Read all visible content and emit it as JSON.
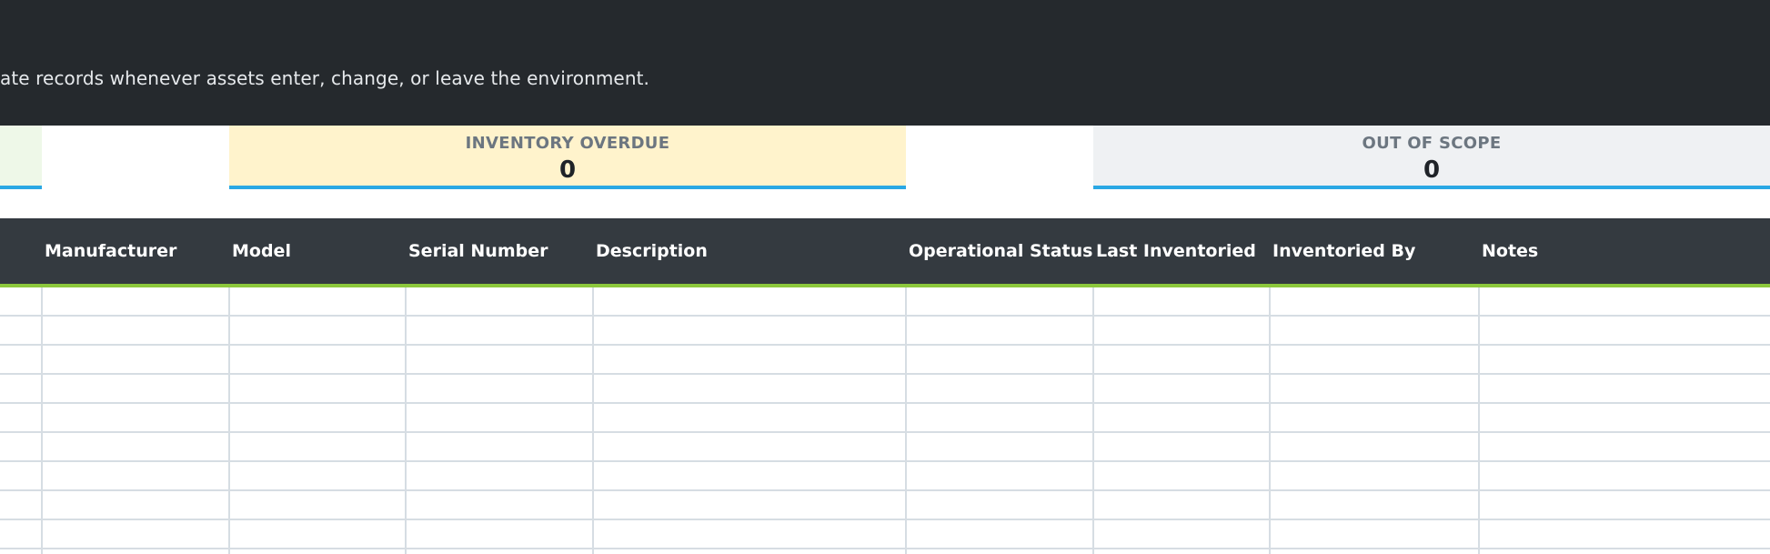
{
  "header": {
    "description": "ate records whenever assets enter, change, or leave the environment."
  },
  "summary_cards": [
    {
      "label": "",
      "value": ""
    },
    {
      "label": "INVENTORY OVERDUE",
      "value": "0"
    },
    {
      "label": "OUT OF SCOPE",
      "value": "0"
    }
  ],
  "table": {
    "columns": [
      "Manufacturer",
      "Model",
      "Serial Number",
      "Description",
      "Operational Status",
      "Last Inventoried",
      "Inventoried By",
      "Notes"
    ],
    "rows": [
      [],
      [],
      [],
      [],
      [],
      [],
      [],
      [],
      []
    ]
  },
  "colors": {
    "header_bg": "#25292d",
    "table_header_bg": "#343a40",
    "card_accent": "#2aa8e4",
    "table_accent": "#8cc83c",
    "overdue_bg": "#fff3cc",
    "out_of_scope_bg": "#eff1f3"
  }
}
